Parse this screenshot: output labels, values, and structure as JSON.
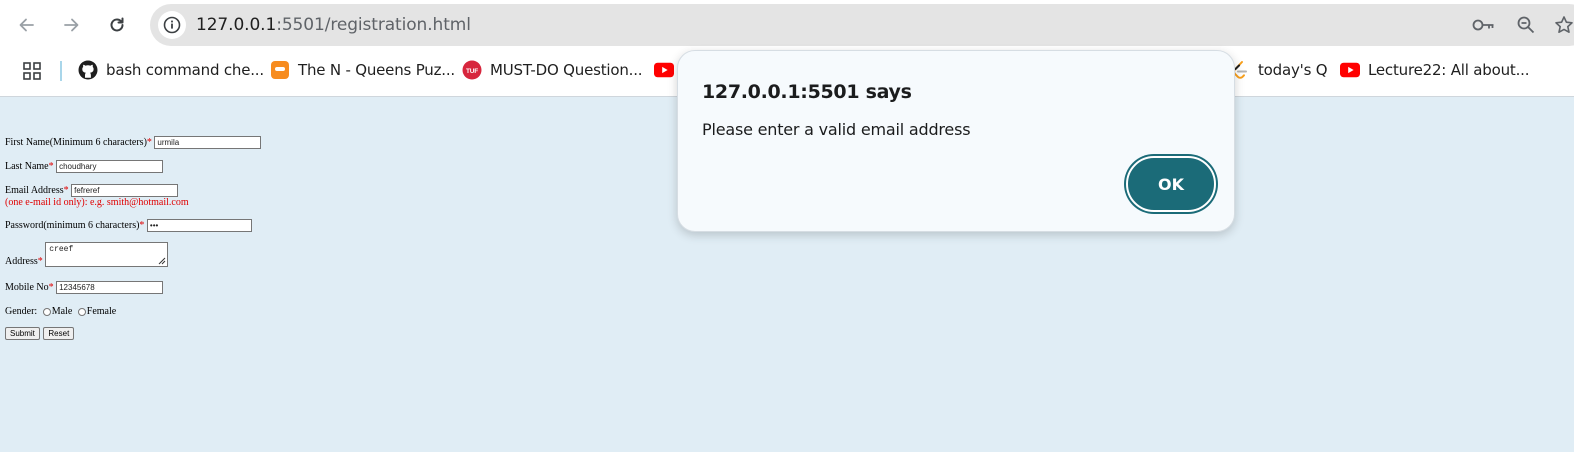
{
  "browser": {
    "url_host": "127.0.0.1",
    "url_rest": ":5501/registration.html",
    "bookmarks": [
      {
        "label": "bash command che...",
        "icon": "github-icon"
      },
      {
        "label": "The N - Queens Puz...",
        "icon": "codestudio-icon"
      },
      {
        "label": "MUST-DO Question...",
        "icon": "takeuforward-icon"
      },
      {
        "label": "",
        "icon": "youtube-icon"
      },
      {
        "label": "today's Q",
        "icon": "leetcode-icon"
      },
      {
        "label": "Lecture22: All about...",
        "icon": "youtube-icon"
      }
    ]
  },
  "form": {
    "first_name_label": "First Name(Minimum 6 characters)",
    "first_name_value": "urmila",
    "last_name_label": "Last Name",
    "last_name_value": "choudhary",
    "email_label": "Email Address",
    "email_value": "fefreref",
    "email_hint": "(one e-mail id only): e.g. smith@hotmail.com",
    "password_label": "Password(minimum 6 characters)",
    "password_value": "•••",
    "address_label": "Address",
    "address_value": "creef",
    "mobile_label": "Mobile No",
    "mobile_value": "12345678",
    "gender_label": "Gender:",
    "gender_options": [
      "Male",
      "Female"
    ],
    "required_mark": "*",
    "submit_label": "Submit",
    "reset_label": "Reset"
  },
  "dialog": {
    "title": "127.0.0.1:5501 says",
    "message": "Please enter a valid email address",
    "ok_label": "OK"
  },
  "colors": {
    "page_bg": "#e0edf5",
    "required": "#e00000",
    "ok_button": "#1b6b78"
  }
}
